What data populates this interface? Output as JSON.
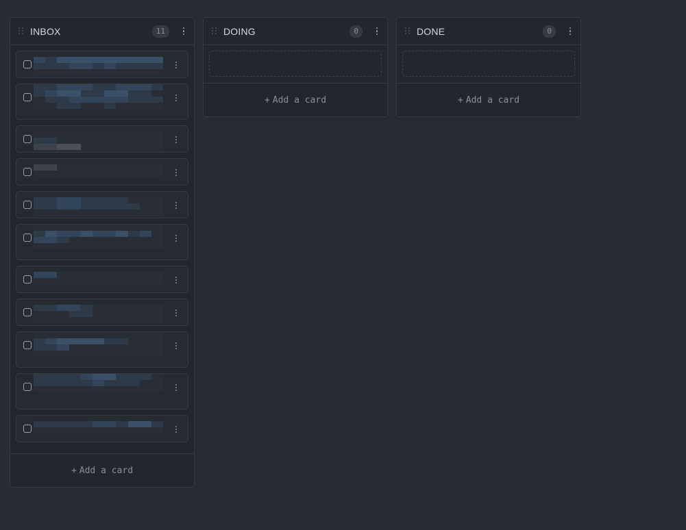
{
  "columns": [
    {
      "title": "INBOX",
      "count": "11",
      "add_label": "Add a card",
      "cards": [
        {
          "rows": [
            "21333333333",
            "11122121111",
            "00000000000"
          ]
        },
        {
          "rows": [
            "11222112221",
            "12331133110",
            "01122222111",
            "00110010000"
          ]
        },
        {
          "rows": [
            "00000000000",
            "11000000000",
            "55660000000",
            "00000000000"
          ]
        },
        {
          "rows": [
            "55000000000",
            "00000000000"
          ]
        },
        {
          "rows": [
            "11221111000",
            "11221111100",
            "00000000000"
          ]
        },
        {
          "rows": [
            "00000000000",
            "13223223120",
            "22100000000",
            "00000000000"
          ]
        },
        {
          "rows": [
            "22000000000",
            "00000000000"
          ]
        },
        {
          "rows": [
            "11221000000",
            "00011000000",
            "00000000000"
          ]
        },
        {
          "rows": [
            "00000000000",
            "12333311000",
            "11200000000",
            "00000000000"
          ]
        },
        {
          "rows": [
            "11112331110",
            "11111211100",
            "00000000000"
          ]
        },
        {
          "rows": [
            "11111221331",
            "00000000000"
          ]
        }
      ]
    },
    {
      "title": "DOING",
      "count": "0",
      "add_label": "Add a card",
      "cards": []
    },
    {
      "title": "DONE",
      "count": "0",
      "add_label": "Add a card",
      "cards": []
    }
  ],
  "add_plus": "+",
  "colors": {
    "background": "#272b33",
    "column": "#22262d",
    "card": "#262a31",
    "blur_palette": [
      "#292d35",
      "#2f3a49",
      "#33455b",
      "#3a5069",
      "#3f5a77",
      "#3d424b",
      "#4b4f57"
    ]
  }
}
